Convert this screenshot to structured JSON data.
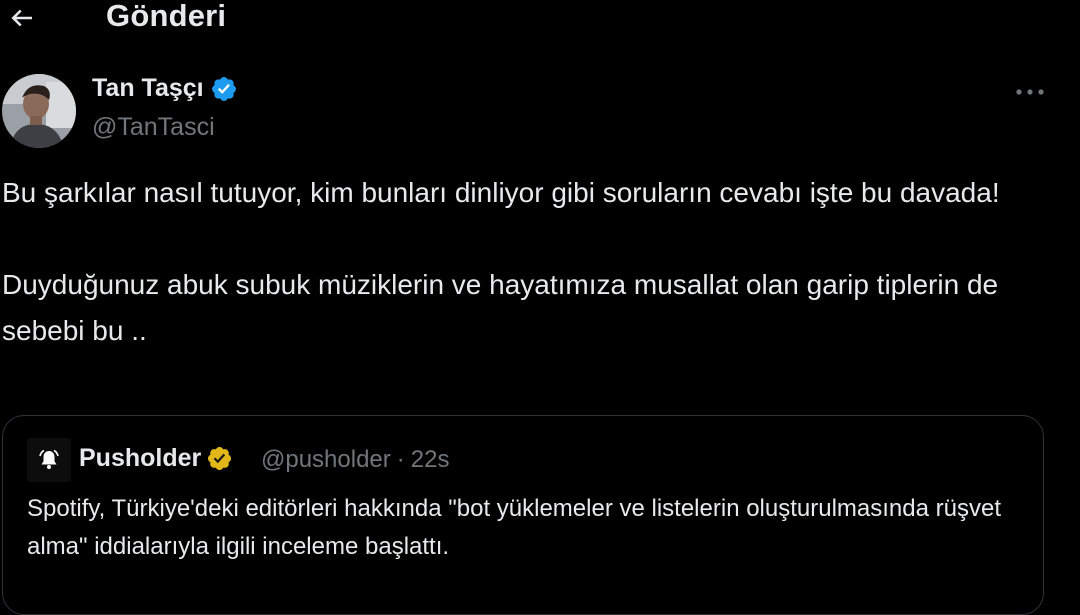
{
  "header": {
    "title": "Gönderi",
    "back_icon": "arrow-left-icon"
  },
  "post": {
    "author_name": "Tan Taşçı",
    "author_handle": "@TanTasci",
    "verified": true,
    "verified_color": "#1d9bf0",
    "more_icon": "more-horizontal-icon",
    "text": "Bu şarkılar nasıl tutuyor, kim bunları dinliyor gibi soruların cevabı işte bu davada!\n\nDuyduğunuz abuk subuk müziklerin ve hayatımıza musallat olan garip tiplerin de sebebi bu .."
  },
  "quote": {
    "author_name": "Pusholder",
    "author_handle": "@pusholder",
    "separator": "·",
    "time": "22s",
    "verified_color": "#e2b719",
    "avatar_icon": "bell-icon",
    "text": "Spotify, Türkiye'deki editörleri hakkında \"bot yüklemeler ve listelerin oluşturulmasında rüşvet alma\" iddialarıyla ilgili inceleme başlattı."
  },
  "colors": {
    "background": "#000000",
    "primary_text": "#e7e9ea",
    "secondary_text": "#71767b",
    "border": "#2f3336"
  }
}
